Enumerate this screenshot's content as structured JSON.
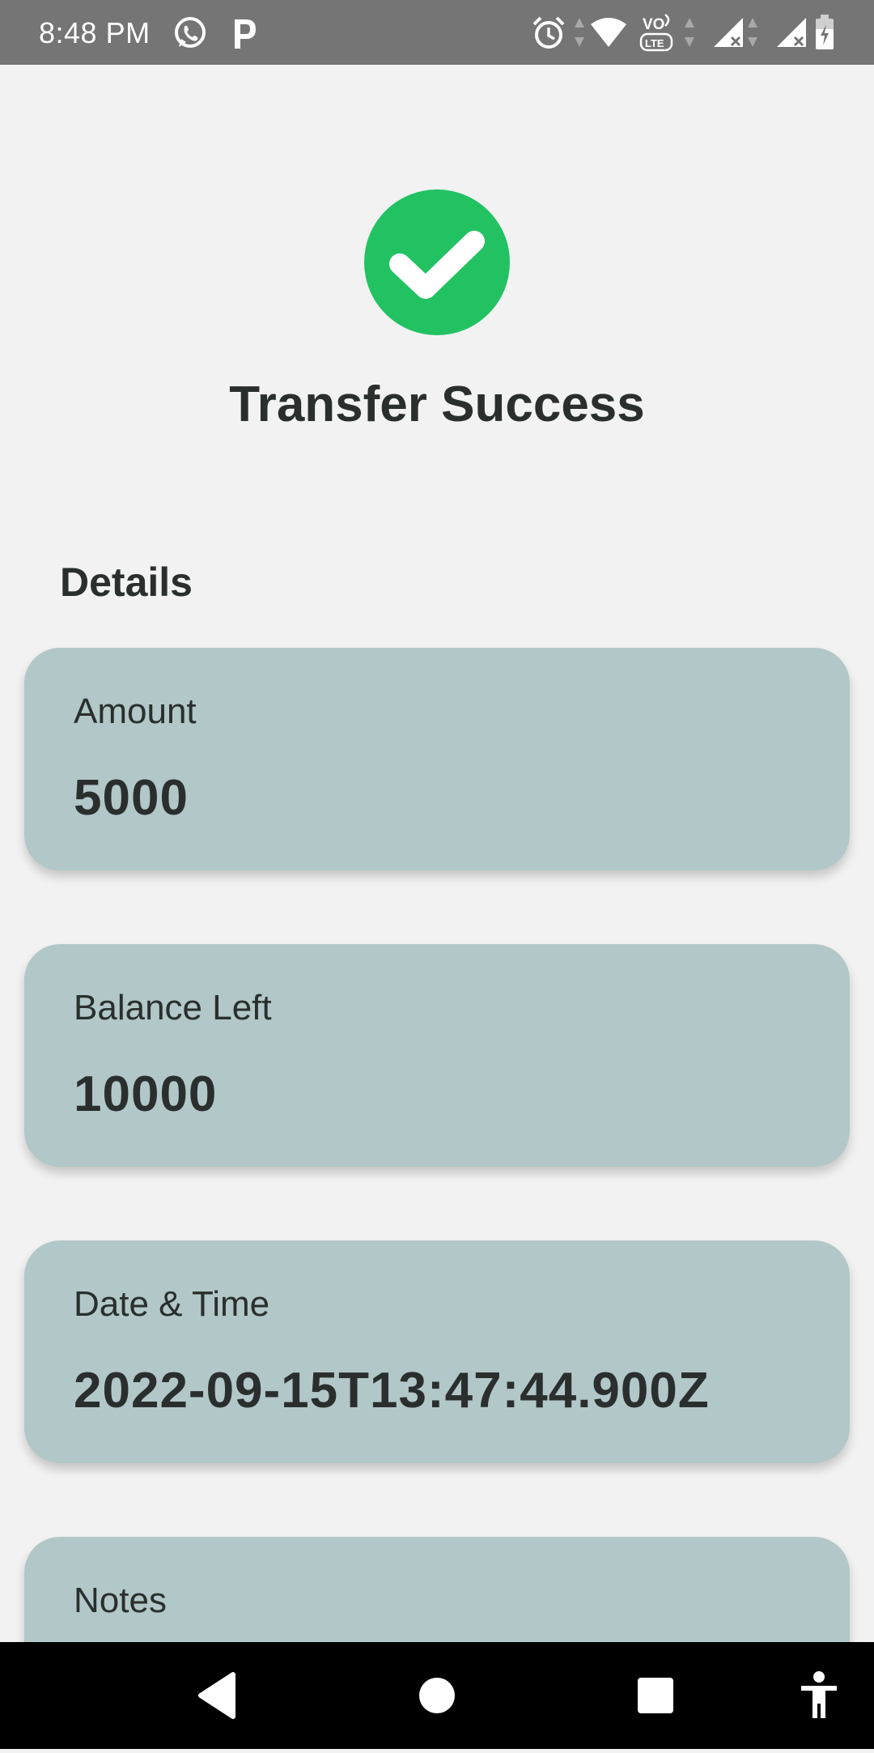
{
  "status_bar": {
    "time": "8:48 PM",
    "icons": [
      "whatsapp-icon",
      "parking-p-icon",
      "alarm-icon",
      "wifi-icon",
      "volte-icon",
      "signal-icon",
      "signal-icon",
      "battery-icon"
    ]
  },
  "header": {
    "icon": "check-circle-icon",
    "title": "Transfer Success"
  },
  "details": {
    "heading": "Details",
    "cards": [
      {
        "label": "Amount",
        "value": "5000"
      },
      {
        "label": "Balance Left",
        "value": "10000"
      },
      {
        "label": "Date & Time",
        "value": "2022-09-15T13:47:44.900Z"
      },
      {
        "label": "Notes",
        "value": ""
      }
    ]
  },
  "nav_bar": {
    "buttons": [
      "back-icon",
      "home-icon",
      "recents-icon",
      "accessibility-icon"
    ]
  },
  "colors": {
    "success": "#22c262",
    "card_background": "#b2c7c8",
    "text": "#2a2f2d",
    "status_bar": "#757575",
    "background": "#f2f2f2"
  }
}
